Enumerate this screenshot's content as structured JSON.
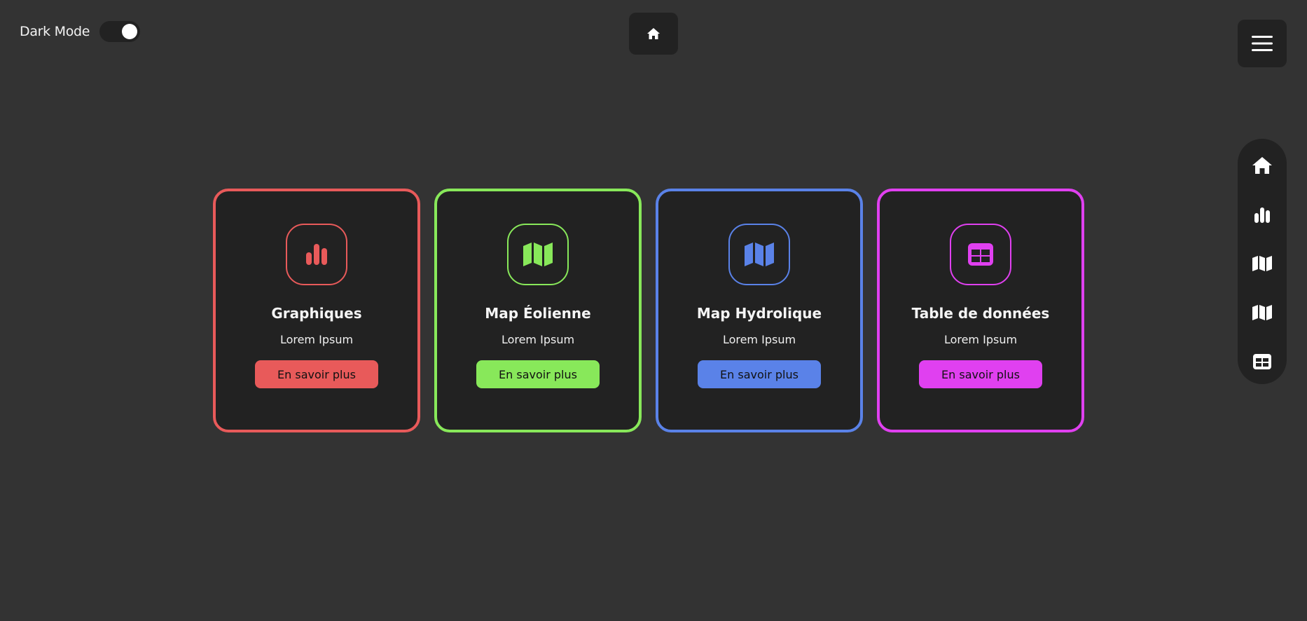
{
  "dark_mode": {
    "label": "Dark Mode",
    "enabled": true
  },
  "top_bar": {
    "home_icon": "home-icon",
    "menu_icon": "hamburger-icon"
  },
  "side_nav": {
    "items": [
      {
        "icon": "home-icon"
      },
      {
        "icon": "bar-chart-icon"
      },
      {
        "icon": "map-icon"
      },
      {
        "icon": "map-icon"
      },
      {
        "icon": "table-icon"
      }
    ]
  },
  "cards": [
    {
      "title": "Graphiques",
      "subtitle": "Lorem Ipsum",
      "button": "En savoir plus",
      "color": "#e85a5a",
      "icon": "bar-chart-icon"
    },
    {
      "title": "Map Éolienne",
      "subtitle": "Lorem Ipsum",
      "button": "En savoir plus",
      "color": "#88e85a",
      "icon": "map-icon"
    },
    {
      "title": "Map Hydrolique",
      "subtitle": "Lorem Ipsum",
      "button": "En savoir plus",
      "color": "#5a82e8",
      "icon": "map-icon"
    },
    {
      "title": "Table de données",
      "subtitle": "Lorem Ipsum",
      "button": "En savoir plus",
      "color": "#e040f0",
      "icon": "table-icon"
    }
  ],
  "colors": {
    "background": "#333333",
    "panel": "#222222"
  }
}
